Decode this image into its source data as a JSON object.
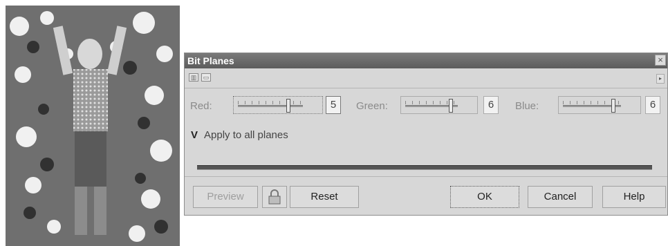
{
  "dialog": {
    "title": "Bit Planes",
    "close_glyph": "×",
    "toolbar": {
      "icons": [
        "split-view-icon",
        "single-view-icon"
      ],
      "right_arrow_glyph": "▸"
    },
    "red": {
      "label": "Red:",
      "value": "5",
      "level": 0.8
    },
    "green": {
      "label": "Green:",
      "value": "6",
      "level": 0.9
    },
    "blue": {
      "label": "Blue:",
      "value": "6",
      "level": 0.9
    },
    "apply_all": {
      "mark": "V",
      "label": "Apply to all planes"
    },
    "progress": 1.0,
    "buttons": {
      "preview": "Preview",
      "reset": "Reset",
      "ok": "OK",
      "cancel": "Cancel",
      "help": "Help"
    }
  },
  "colors": {
    "dialog_bg": "#d7d7d7",
    "titlebar": "#666666",
    "label_text": "#8a8a8a"
  }
}
